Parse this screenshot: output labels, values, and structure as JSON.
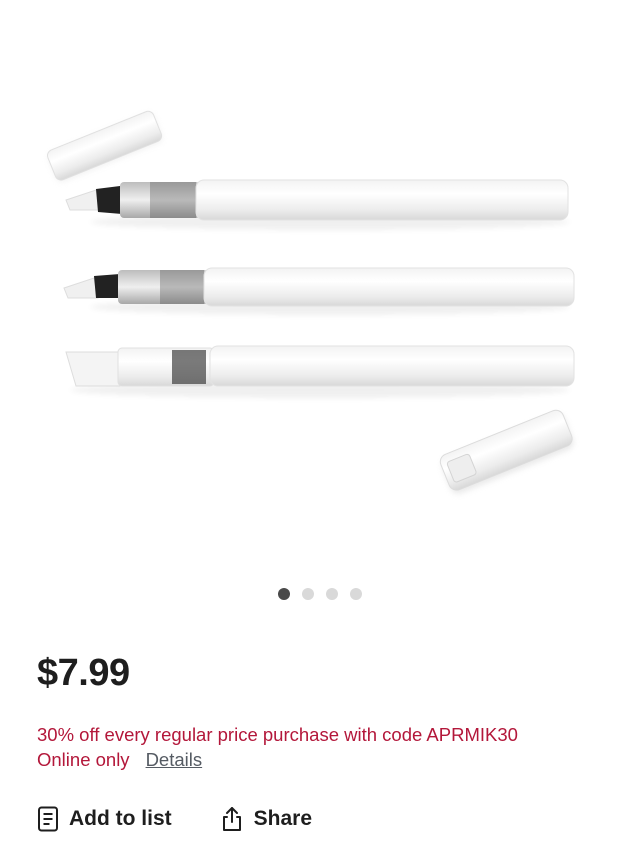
{
  "product": {
    "price": "$7.99",
    "image_icon": "water-brush-pens-image",
    "gallery": {
      "total_images": 4,
      "active_index": 0
    }
  },
  "promo": {
    "offer_text": "30% off every regular price purchase with code APRMIK30",
    "availability": "Online only",
    "details_link": "Details",
    "color": "#b3173a"
  },
  "actions": {
    "add_to_list": {
      "label": "Add to list",
      "icon": "list-icon"
    },
    "share": {
      "label": "Share",
      "icon": "share-icon"
    }
  }
}
